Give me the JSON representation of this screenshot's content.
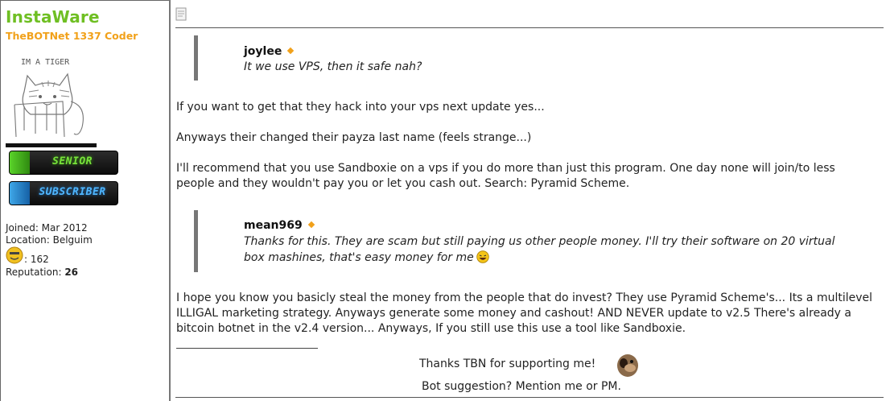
{
  "user": {
    "name": "InstaWare",
    "title": "TheBOTNet 1337 Coder",
    "avatar_caption": "IM A TIGER",
    "badges": [
      {
        "label": "SENIOR",
        "color": "#5ad32a"
      },
      {
        "label": "SUBSCRIBER",
        "color": "#3fa7e8"
      }
    ],
    "joined": "Joined: Mar 2012",
    "location": "Location: Belguim",
    "coins": ": 162",
    "reputation_label": "Reputation: ",
    "reputation_value": "26"
  },
  "post": {
    "icon": "post-icon",
    "quotes": [
      {
        "author": "joylee",
        "text": "It we use VPS, then it safe nah?"
      },
      {
        "author": "mean969",
        "text": "Thanks for this. They are scam but still paying us other people money. I'll try their software on 20 virtual box mashines, that's easy money for me"
      }
    ],
    "paragraph1": "If you want to get that they hack into your vps next update yes...",
    "paragraph2": "Anyways their changed their payza last name (feels strange...)",
    "paragraph3": "I'll recommend that you use Sandboxie on a vps if you do more than just this program. One day none will join/to less people and they wouldn't pay you or let you cash out. Search: Pyramid Scheme.",
    "paragraph4": "I hope you know you basicly steal the money from the people that do invest? They use Pyramid Scheme's... Its a multilevel ILLIGAL marketing strategy. Anyways generate some money and cashout! AND NEVER update to v2.5 There's already a bitcoin botnet in the v2.4 version... Anyways, If you still use this use a tool like Sandboxie."
  },
  "signature": {
    "line1": "Thanks TBN for supporting me!",
    "line2": "Bot suggestion? Mention me or PM."
  },
  "colors": {
    "username": "#6fbf23",
    "usertitle": "#f1a11a",
    "quote_bar": "#777777"
  }
}
